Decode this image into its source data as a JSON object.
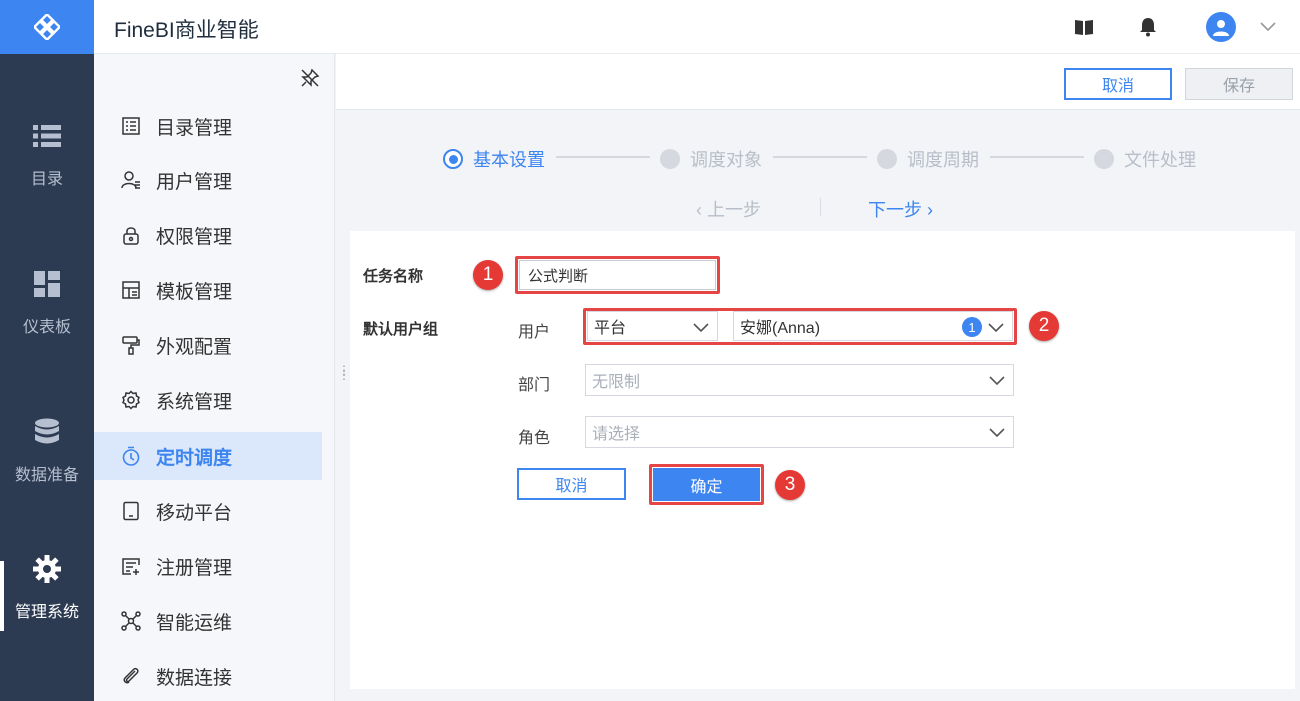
{
  "app": {
    "title": "FineBI商业智能"
  },
  "rail": {
    "items": [
      {
        "label": "目录",
        "icon": "list-icon"
      },
      {
        "label": "仪表板",
        "icon": "dashboard-icon"
      },
      {
        "label": "数据准备",
        "icon": "database-icon"
      },
      {
        "label": "管理系统",
        "icon": "gear-icon",
        "active": true
      }
    ]
  },
  "sidebar": {
    "items": [
      {
        "label": "目录管理",
        "icon": "catalog-icon"
      },
      {
        "label": "用户管理",
        "icon": "user-icon"
      },
      {
        "label": "权限管理",
        "icon": "lock-icon"
      },
      {
        "label": "模板管理",
        "icon": "template-icon"
      },
      {
        "label": "外观配置",
        "icon": "paint-roller-icon"
      },
      {
        "label": "系统管理",
        "icon": "cog-icon"
      },
      {
        "label": "定时调度",
        "icon": "timer-icon",
        "active": true
      },
      {
        "label": "移动平台",
        "icon": "tablet-icon"
      },
      {
        "label": "注册管理",
        "icon": "register-icon"
      },
      {
        "label": "智能运维",
        "icon": "network-icon"
      },
      {
        "label": "数据连接",
        "icon": "paperclip-icon"
      }
    ]
  },
  "toolbar": {
    "cancel_label": "取消",
    "save_label": "保存"
  },
  "steps": [
    {
      "label": "基本设置",
      "active": true
    },
    {
      "label": "调度对象"
    },
    {
      "label": "调度周期"
    },
    {
      "label": "文件处理"
    }
  ],
  "nav": {
    "prev_label": "上一步",
    "next_label": "下一步"
  },
  "form": {
    "task_name_label": "任务名称",
    "task_name_value": "公式判断",
    "default_user_group_label": "默认用户组",
    "user_label": "用户",
    "user_source_value": "平台",
    "user_value": "安娜(Anna)",
    "user_count": "1",
    "dept_label": "部门",
    "dept_value": "无限制",
    "role_label": "角色",
    "role_placeholder": "请选择",
    "cancel_label": "取消",
    "confirm_label": "确定"
  },
  "annotations": {
    "step1": "1",
    "step2": "2",
    "step3": "3"
  },
  "colors": {
    "accent": "#3d85f0",
    "rail_bg": "#2c3a52",
    "highlight": "#e54545"
  }
}
